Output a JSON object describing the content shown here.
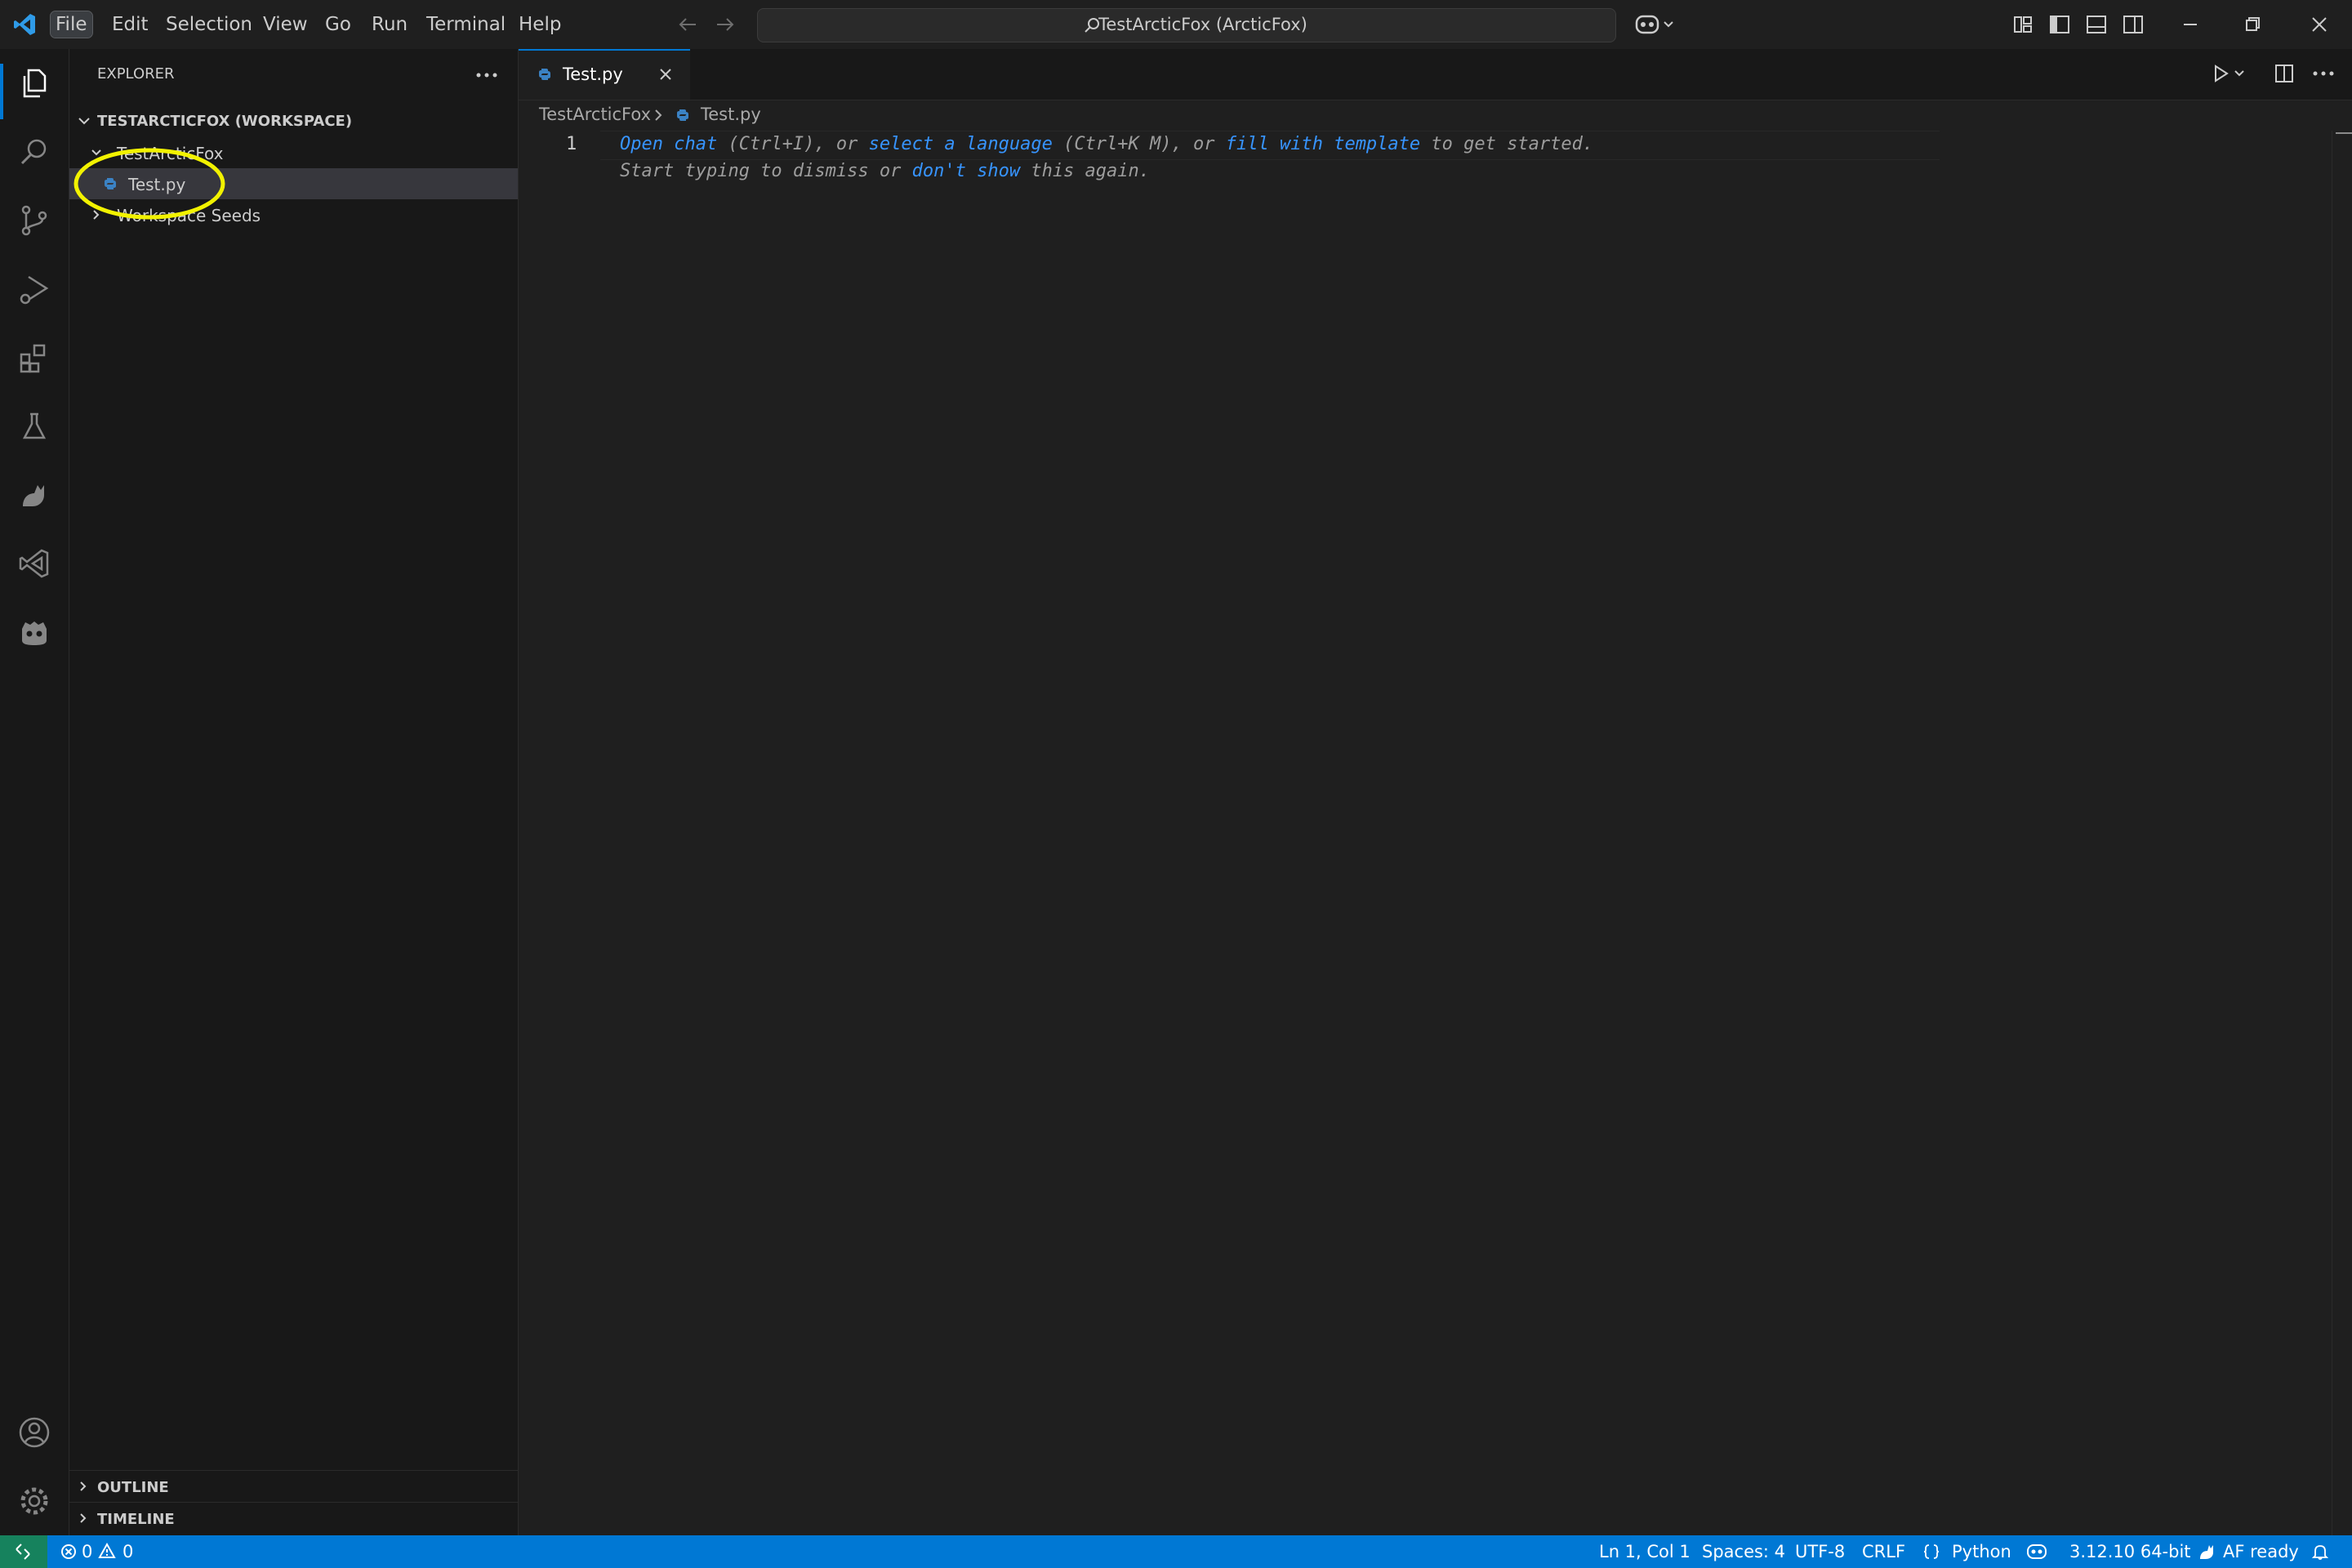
{
  "menu": [
    "File",
    "Edit",
    "Selection",
    "View",
    "Go",
    "Run",
    "Terminal",
    "Help"
  ],
  "command_center": {
    "label": "TestArcticFox (ArcticFox)"
  },
  "sidebar": {
    "title": "EXPLORER",
    "workspace": "TESTARCTICFOX (WORKSPACE)",
    "folders": [
      {
        "label": "TestArcticFox"
      },
      {
        "label": "Test.py"
      },
      {
        "label": "Workspace Seeds"
      }
    ],
    "outline": "OUTLINE",
    "timeline": "TIMELINE"
  },
  "editor": {
    "tab_label": "Test.py",
    "breadcrumb": {
      "folder": "TestArcticFox",
      "file": "Test.py"
    },
    "line_number": "1",
    "hint": {
      "open_chat": "Open chat",
      "ctrl_i": " (Ctrl+I), or ",
      "select_language": "select a language",
      "ctrl_k": " (Ctrl+K M), or ",
      "fill_template": "fill with template",
      "get_started": " to get started.",
      "start_typing": "Start typing to dismiss or ",
      "dont_show": "don't show",
      "this_again": " this again."
    }
  },
  "statusbar": {
    "errors": "0",
    "warnings": "0",
    "position": "Ln 1, Col 1",
    "spaces": "Spaces: 4",
    "encoding": "UTF-8",
    "eol": "CRLF",
    "language": "Python",
    "interpreter": "3.12.10 64-bit",
    "af_status": "AF ready"
  },
  "colors": {
    "accent": "#0078d4",
    "link": "#3794ff",
    "highlight_circle": "#f2f200"
  }
}
